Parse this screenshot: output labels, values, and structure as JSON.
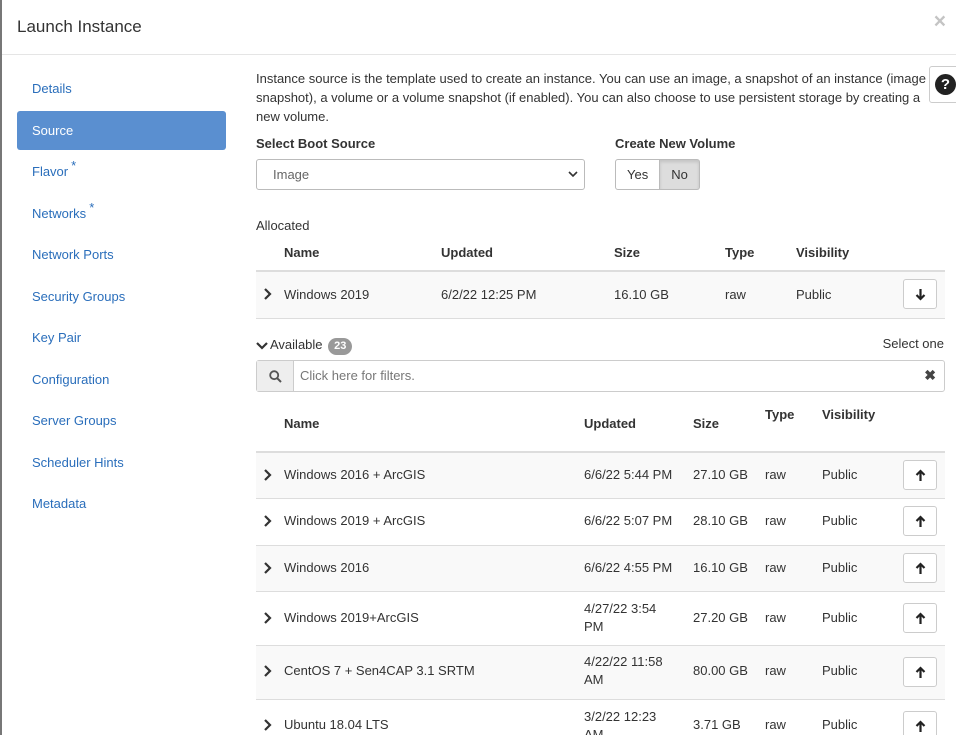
{
  "modal": {
    "title": "Launch Instance",
    "close_glyph": "×"
  },
  "sidebar": {
    "items": [
      {
        "label": "Details",
        "required": false
      },
      {
        "label": "Source",
        "required": false,
        "active": true
      },
      {
        "label": "Flavor",
        "required": true
      },
      {
        "label": "Networks",
        "required": true
      },
      {
        "label": "Network Ports",
        "required": false
      },
      {
        "label": "Security Groups",
        "required": false
      },
      {
        "label": "Key Pair",
        "required": false
      },
      {
        "label": "Configuration",
        "required": false
      },
      {
        "label": "Server Groups",
        "required": false
      },
      {
        "label": "Scheduler Hints",
        "required": false
      },
      {
        "label": "Metadata",
        "required": false
      }
    ],
    "required_mark": "*"
  },
  "source": {
    "help_text": "Instance source is the template used to create an instance. You can use an image, a snapshot of an instance (image snapshot), a volume or a volume snapshot (if enabled). You can also choose to use persistent storage by creating a new volume.",
    "help_icon": "?",
    "boot_source_label": "Select Boot Source",
    "boot_source_value": "Image",
    "new_volume_label": "Create New Volume",
    "yes_label": "Yes",
    "no_label": "No",
    "new_volume_selected": "No"
  },
  "allocated": {
    "label": "Allocated",
    "columns": [
      "Name",
      "Updated",
      "Size",
      "Type",
      "Visibility"
    ],
    "rows": [
      {
        "name": "Windows 2019",
        "updated": "6/2/22 12:25 PM",
        "size": "16.10 GB",
        "type": "raw",
        "visibility": "Public"
      }
    ]
  },
  "available": {
    "label": "Available",
    "count": "23",
    "select_hint": "Select one",
    "filter_placeholder": "Click here for filters.",
    "clear_glyph": "✖",
    "columns": [
      "Name",
      "Updated",
      "Size",
      "Type",
      "Visibility"
    ],
    "rows": [
      {
        "name": "Windows 2016 + ArcGIS",
        "updated_1": "6/6/22 5:44 PM",
        "updated_2": "",
        "size": "27.10 GB",
        "type": "raw",
        "visibility": "Public"
      },
      {
        "name": "Windows 2019 + ArcGIS",
        "updated_1": "6/6/22 5:07 PM",
        "updated_2": "",
        "size": "28.10 GB",
        "type": "raw",
        "visibility": "Public"
      },
      {
        "name": "Windows 2016",
        "updated_1": "6/6/22 4:55 PM",
        "updated_2": "",
        "size": "16.10 GB",
        "type": "raw",
        "visibility": "Public"
      },
      {
        "name": "Windows 2019+ArcGIS",
        "updated_1": "4/27/22 3:54",
        "updated_2": "PM",
        "size": "27.20 GB",
        "type": "raw",
        "visibility": "Public"
      },
      {
        "name": "CentOS 7 + Sen4CAP 3.1 SRTM",
        "updated_1": "4/22/22 11:58",
        "updated_2": "AM",
        "size": "80.00 GB",
        "type": "raw",
        "visibility": "Public"
      },
      {
        "name": "Ubuntu 18.04 LTS",
        "updated_1": "3/2/22 12:23",
        "updated_2": "AM",
        "size": "3.71 GB",
        "type": "raw",
        "visibility": "Public"
      }
    ]
  }
}
